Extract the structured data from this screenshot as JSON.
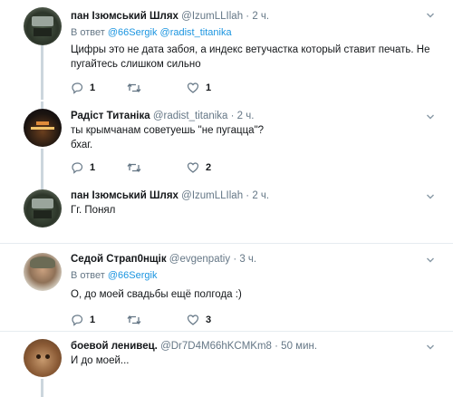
{
  "tweets": [
    {
      "name": "пан Ізюмський Шлях",
      "handle": "@IzumLLIlah",
      "time": "· 2 ч.",
      "reply_label": "В ответ",
      "reply_users": [
        "@66Sergik",
        "@radist_titanika"
      ],
      "lines": [
        "Цифры это не дата забоя, а индекс ветучастка который ставит печать. Не",
        "пугайтесь слишком сильно"
      ],
      "replies": "1",
      "retweets": "",
      "likes": "1",
      "avatar": "truck"
    },
    {
      "name": "Радіст Титаніка",
      "handle": "@radist_titanika",
      "time": "· 2 ч.",
      "lines": [
        "ты крымчанам советуешь \"не пугацца\"?",
        "бхаг."
      ],
      "replies": "1",
      "retweets": "",
      "likes": "2",
      "avatar": "night"
    },
    {
      "name": "пан Ізюмський Шлях",
      "handle": "@IzumLLIlah",
      "time": "· 2 ч.",
      "lines": [
        "Гг. Понял"
      ],
      "avatar": "truck"
    },
    {
      "name": "Седой Страп0нщік",
      "handle": "@evgenpatiy",
      "time": "· 3 ч.",
      "reply_label": "В ответ",
      "reply_users": [
        "@66Sergik"
      ],
      "lines": [
        "О, до моей свадьбы ещё полгода :)"
      ],
      "replies": "1",
      "retweets": "",
      "likes": "3",
      "avatar": "face"
    },
    {
      "name": "боевой ленивец.",
      "handle": "@Dr7D4M66hKCMKm8",
      "time": "· 50 мин.",
      "lines": [
        "И до моей..."
      ],
      "avatar": "sloth"
    }
  ],
  "icons": {
    "reply": "reply-icon",
    "retweet": "retweet-icon",
    "like": "heart-icon",
    "more": "chevron-down-icon"
  },
  "colors": {
    "link": "#1b95e0",
    "secondary": "#657786",
    "thread_line": "#ccd6dd",
    "divider": "#e6ecf0"
  }
}
